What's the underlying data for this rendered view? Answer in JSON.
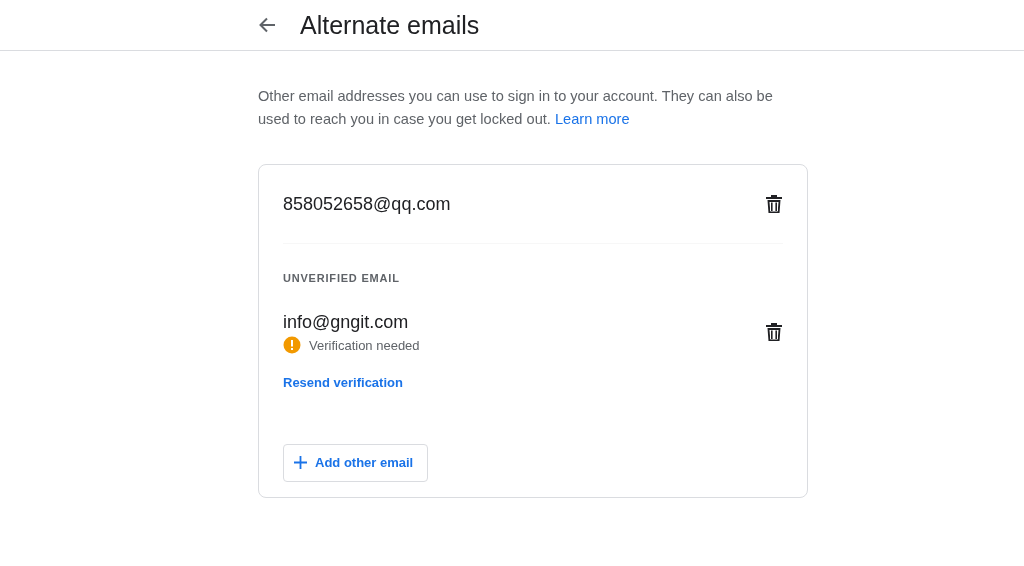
{
  "header": {
    "title": "Alternate emails"
  },
  "description": {
    "text": "Other email addresses you can use to sign in to your account. They can also be used to reach you in case you get locked out.",
    "link": "Learn more"
  },
  "card": {
    "emails": [
      {
        "email": "858052658@qq.com"
      }
    ],
    "unverified": {
      "heading": "UNVERIFIED EMAIL",
      "emails": [
        {
          "email": "info@gngit.com",
          "status": "Verification needed",
          "action": "Resend verification"
        }
      ]
    },
    "add_button": "Add other email"
  }
}
